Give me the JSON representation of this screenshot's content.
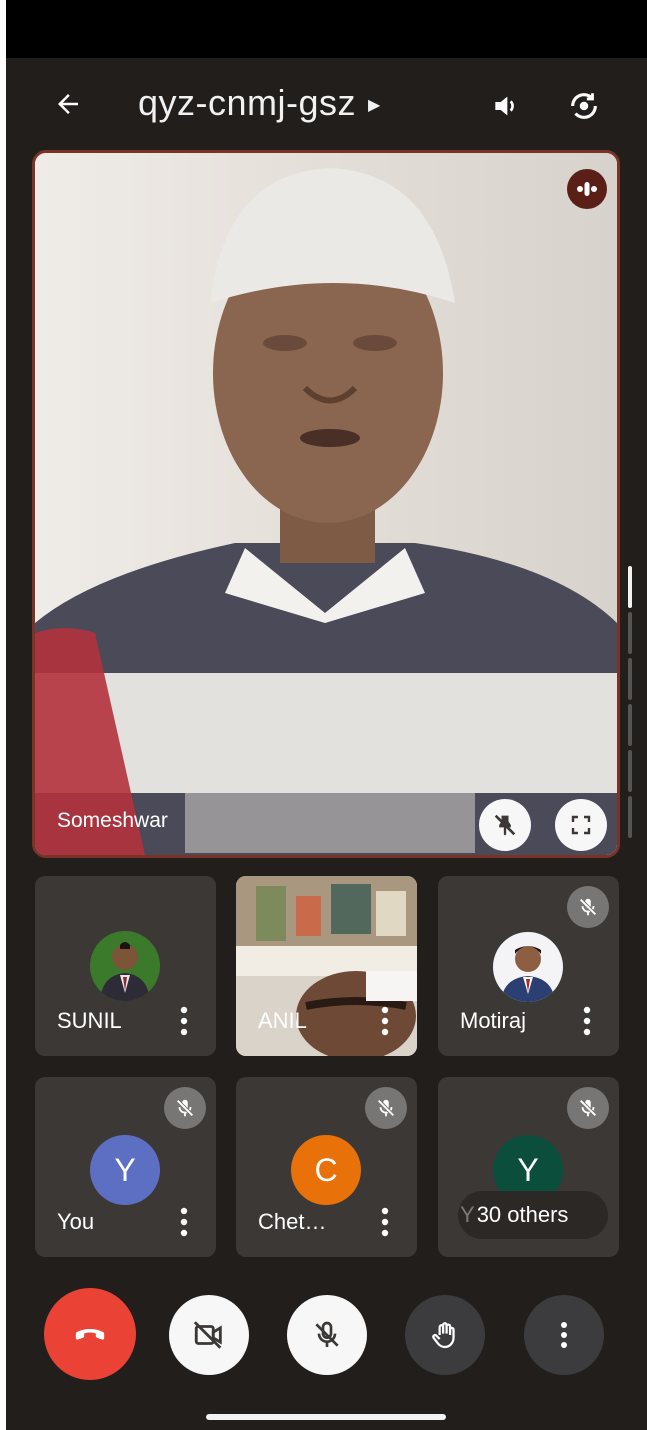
{
  "meeting": {
    "code": "qyz-cnmj-gsz"
  },
  "icons": {
    "back": "arrow-left-icon",
    "details": "caret-right-icon",
    "speaker": "speaker-icon",
    "camera_switch": "camera-switch-icon"
  },
  "main": {
    "participant": "Someshwar",
    "speaking": true,
    "border_color": "#7a3427"
  },
  "tiles": [
    {
      "name": "SUNIL",
      "muted": false,
      "type": "photo"
    },
    {
      "name": "ANIL",
      "muted": false,
      "type": "video"
    },
    {
      "name": "Motiraj",
      "muted": true,
      "type": "photo"
    },
    {
      "name": "You",
      "muted": true,
      "type": "letter",
      "letter": "Y",
      "color": "#5d6fc2"
    },
    {
      "name": "Chet…",
      "muted": true,
      "type": "letter",
      "letter": "C",
      "color": "#e8710a"
    },
    {
      "name": "Y",
      "muted": true,
      "type": "letter",
      "letter": "Y",
      "color": "#0b4e3b",
      "others_label": "30 others"
    }
  ],
  "controls": {
    "end_call_color": "#ea4335",
    "items": [
      "end-call",
      "camera-off",
      "mic-off",
      "raise-hand",
      "more-options"
    ]
  }
}
